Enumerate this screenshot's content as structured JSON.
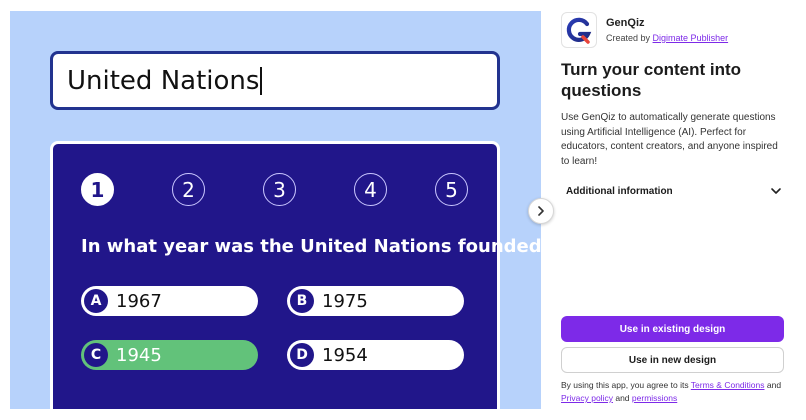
{
  "preview": {
    "topic_value": "United Nations",
    "steps": [
      "1",
      "2",
      "3",
      "4",
      "5"
    ],
    "active_step": "1",
    "question": "In what year was the United Nations founded?",
    "answers": [
      {
        "letter": "A",
        "text": "1967",
        "correct": false
      },
      {
        "letter": "B",
        "text": "1975",
        "correct": false
      },
      {
        "letter": "C",
        "text": "1945",
        "correct": true
      },
      {
        "letter": "D",
        "text": "1954",
        "correct": false
      }
    ],
    "colors": {
      "background": "#b7d2fb",
      "card": "#21168a",
      "correct": "#62c27a"
    }
  },
  "app": {
    "name": "GenQiz",
    "created_by_prefix": "Created by",
    "publisher": "Digimate Publisher",
    "headline": "Turn your content into questions",
    "description": "Use GenQiz to automatically generate questions using Artificial Intelligence (AI). Perfect for educators, content creators, and anyone inspired to learn!",
    "additional_info_label": "Additional information",
    "use_existing_label": "Use in existing design",
    "use_new_label": "Use in new design",
    "legal": {
      "prefix": "By using this app, you agree to its",
      "terms": "Terms & Conditions",
      "and1": "and",
      "privacy": "Privacy policy",
      "and2": "and",
      "permissions": "permissions"
    },
    "accent_color": "#7d2ae8"
  },
  "icons": {
    "next": "chevron-right-icon",
    "expand": "chevron-down-icon",
    "logo": "genqiz-logo-icon"
  }
}
